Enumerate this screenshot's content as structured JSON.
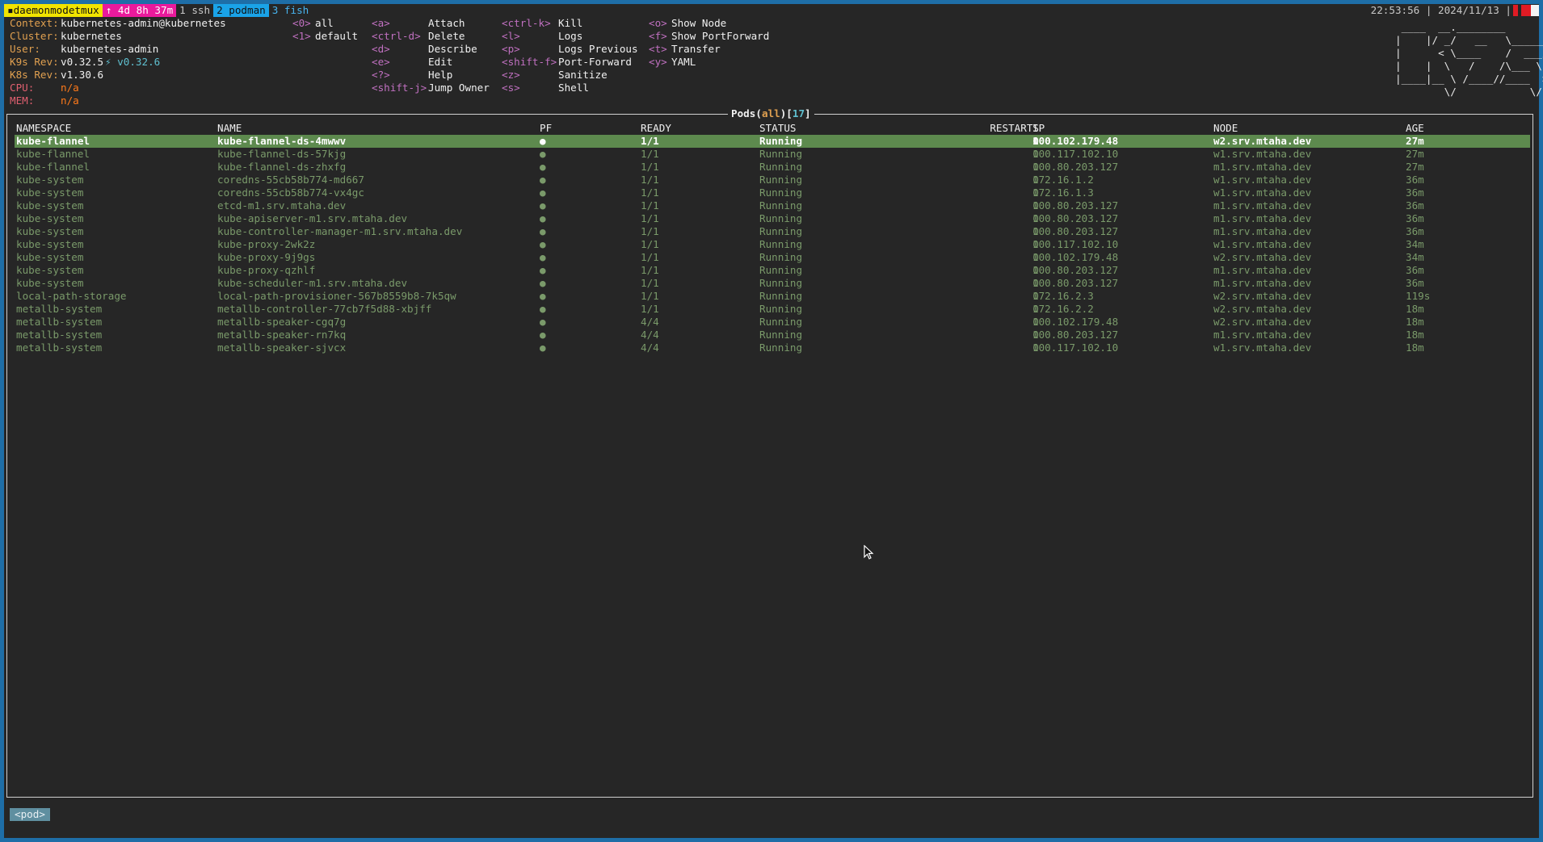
{
  "tmux": {
    "session": "daemonmodetmux",
    "uptime": "4d 8h 37m",
    "windows": [
      "1 ssh",
      "2 podman",
      "3 fish"
    ],
    "clock": "22:53:56 | 2024/11/13 |"
  },
  "info": {
    "context_label": "Context:",
    "context": "kubernetes-admin@kubernetes",
    "cluster_label": "Cluster:",
    "cluster": "kubernetes",
    "user_label": "User:",
    "user": "kubernetes-admin",
    "k9s_label": "K9s Rev:",
    "k9s": "v0.32.5",
    "k9s_upgrade": "⚡ v0.32.6",
    "k8s_label": "K8s Rev:",
    "k8s": "v1.30.6",
    "cpu_label": "CPU:",
    "cpu": "n/a",
    "mem_label": "MEM:",
    "mem": "n/a"
  },
  "namespaces": [
    {
      "key": "<0>",
      "label": "all"
    },
    {
      "key": "<1>",
      "label": "default"
    }
  ],
  "hotkeys_col1": [
    {
      "key": "<a>",
      "label": "Attach"
    },
    {
      "key": "<ctrl-d>",
      "label": "Delete"
    },
    {
      "key": "<d>",
      "label": "Describe"
    },
    {
      "key": "<e>",
      "label": "Edit"
    },
    {
      "key": "<?>",
      "label": "Help"
    },
    {
      "key": "<shift-j>",
      "label": "Jump Owner"
    }
  ],
  "hotkeys_col2": [
    {
      "key": "<ctrl-k>",
      "label": "Kill"
    },
    {
      "key": "<l>",
      "label": "Logs"
    },
    {
      "key": "<p>",
      "label": "Logs Previous"
    },
    {
      "key": "<shift-f>",
      "label": "Port-Forward"
    },
    {
      "key": "<z>",
      "label": "Sanitize"
    },
    {
      "key": "<s>",
      "label": "Shell"
    }
  ],
  "hotkeys_col3": [
    {
      "key": "<o>",
      "label": "Show Node"
    },
    {
      "key": "<f>",
      "label": "Show PortForward"
    },
    {
      "key": "<t>",
      "label": "Transfer"
    },
    {
      "key": "<y>",
      "label": "YAML"
    }
  ],
  "logo": " ____  __.________        \n|    |/ _/   __   \\______\n|      < \\____    /  ___/\n|    |  \\   /    /\\___ \\ \n|____|__ \\ /____//____  >\n        \\/            \\/ ",
  "pane": {
    "resource": "Pods",
    "scope": "all",
    "count": "17"
  },
  "columns": [
    "NAMESPACE",
    "NAME",
    "PF",
    "READY",
    "STATUS",
    "RESTARTS",
    "IP",
    "NODE",
    "AGE"
  ],
  "pods": [
    {
      "ns": "kube-flannel",
      "name": "kube-flannel-ds-4mwwv",
      "pf": "●",
      "ready": "1/1",
      "status": "Running",
      "restarts": "0",
      "ip": "100.102.179.48",
      "node": "w2.srv.mtaha.dev",
      "age": "27m"
    },
    {
      "ns": "kube-flannel",
      "name": "kube-flannel-ds-57kjg",
      "pf": "●",
      "ready": "1/1",
      "status": "Running",
      "restarts": "0",
      "ip": "100.117.102.10",
      "node": "w1.srv.mtaha.dev",
      "age": "27m"
    },
    {
      "ns": "kube-flannel",
      "name": "kube-flannel-ds-zhxfg",
      "pf": "●",
      "ready": "1/1",
      "status": "Running",
      "restarts": "0",
      "ip": "100.80.203.127",
      "node": "m1.srv.mtaha.dev",
      "age": "27m"
    },
    {
      "ns": "kube-system",
      "name": "coredns-55cb58b774-md667",
      "pf": "●",
      "ready": "1/1",
      "status": "Running",
      "restarts": "0",
      "ip": "172.16.1.2",
      "node": "w1.srv.mtaha.dev",
      "age": "36m"
    },
    {
      "ns": "kube-system",
      "name": "coredns-55cb58b774-vx4gc",
      "pf": "●",
      "ready": "1/1",
      "status": "Running",
      "restarts": "0",
      "ip": "172.16.1.3",
      "node": "w1.srv.mtaha.dev",
      "age": "36m"
    },
    {
      "ns": "kube-system",
      "name": "etcd-m1.srv.mtaha.dev",
      "pf": "●",
      "ready": "1/1",
      "status": "Running",
      "restarts": "0",
      "ip": "100.80.203.127",
      "node": "m1.srv.mtaha.dev",
      "age": "36m"
    },
    {
      "ns": "kube-system",
      "name": "kube-apiserver-m1.srv.mtaha.dev",
      "pf": "●",
      "ready": "1/1",
      "status": "Running",
      "restarts": "0",
      "ip": "100.80.203.127",
      "node": "m1.srv.mtaha.dev",
      "age": "36m"
    },
    {
      "ns": "kube-system",
      "name": "kube-controller-manager-m1.srv.mtaha.dev",
      "pf": "●",
      "ready": "1/1",
      "status": "Running",
      "restarts": "0",
      "ip": "100.80.203.127",
      "node": "m1.srv.mtaha.dev",
      "age": "36m"
    },
    {
      "ns": "kube-system",
      "name": "kube-proxy-2wk2z",
      "pf": "●",
      "ready": "1/1",
      "status": "Running",
      "restarts": "0",
      "ip": "100.117.102.10",
      "node": "w1.srv.mtaha.dev",
      "age": "34m"
    },
    {
      "ns": "kube-system",
      "name": "kube-proxy-9j9gs",
      "pf": "●",
      "ready": "1/1",
      "status": "Running",
      "restarts": "0",
      "ip": "100.102.179.48",
      "node": "w2.srv.mtaha.dev",
      "age": "34m"
    },
    {
      "ns": "kube-system",
      "name": "kube-proxy-qzhlf",
      "pf": "●",
      "ready": "1/1",
      "status": "Running",
      "restarts": "0",
      "ip": "100.80.203.127",
      "node": "m1.srv.mtaha.dev",
      "age": "36m"
    },
    {
      "ns": "kube-system",
      "name": "kube-scheduler-m1.srv.mtaha.dev",
      "pf": "●",
      "ready": "1/1",
      "status": "Running",
      "restarts": "0",
      "ip": "100.80.203.127",
      "node": "m1.srv.mtaha.dev",
      "age": "36m"
    },
    {
      "ns": "local-path-storage",
      "name": "local-path-provisioner-567b8559b8-7k5qw",
      "pf": "●",
      "ready": "1/1",
      "status": "Running",
      "restarts": "0",
      "ip": "172.16.2.3",
      "node": "w2.srv.mtaha.dev",
      "age": "119s"
    },
    {
      "ns": "metallb-system",
      "name": "metallb-controller-77cb7f5d88-xbjff",
      "pf": "●",
      "ready": "1/1",
      "status": "Running",
      "restarts": "0",
      "ip": "172.16.2.2",
      "node": "w2.srv.mtaha.dev",
      "age": "18m"
    },
    {
      "ns": "metallb-system",
      "name": "metallb-speaker-cgq7g",
      "pf": "●",
      "ready": "4/4",
      "status": "Running",
      "restarts": "0",
      "ip": "100.102.179.48",
      "node": "w2.srv.mtaha.dev",
      "age": "18m"
    },
    {
      "ns": "metallb-system",
      "name": "metallb-speaker-rn7kq",
      "pf": "●",
      "ready": "4/4",
      "status": "Running",
      "restarts": "0",
      "ip": "100.80.203.127",
      "node": "m1.srv.mtaha.dev",
      "age": "18m"
    },
    {
      "ns": "metallb-system",
      "name": "metallb-speaker-sjvcx",
      "pf": "●",
      "ready": "4/4",
      "status": "Running",
      "restarts": "0",
      "ip": "100.117.102.10",
      "node": "w1.srv.mtaha.dev",
      "age": "18m"
    }
  ],
  "crumb": "<pod>",
  "colors": {
    "selected_row": "#5d8a4e",
    "row_text": "#7a9a6a",
    "label": "#e0a050",
    "hotkey": "#c070c0"
  }
}
